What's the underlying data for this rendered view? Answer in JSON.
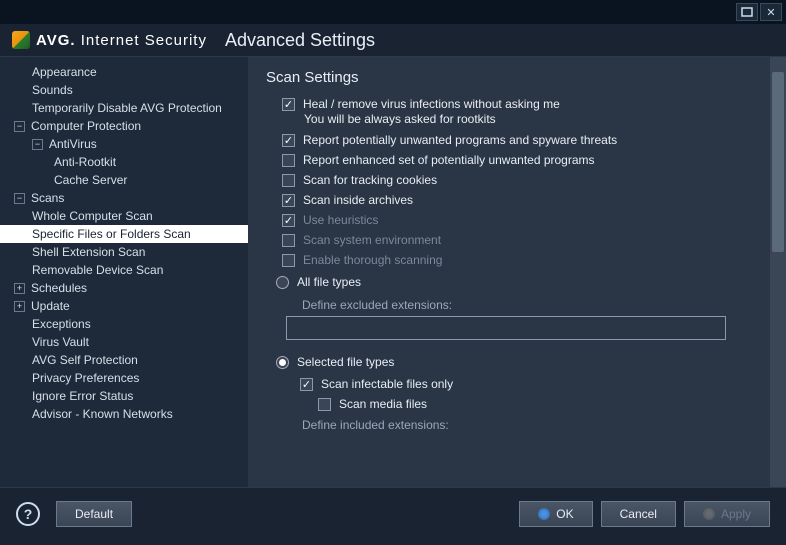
{
  "window": {
    "logo_brand": "AVG.",
    "logo_product": "Internet Security",
    "title": "Advanced Settings"
  },
  "sidebar": {
    "items": [
      {
        "label": "Appearance",
        "level": 1
      },
      {
        "label": "Sounds",
        "level": 1
      },
      {
        "label": "Temporarily Disable AVG Protection",
        "level": 1
      },
      {
        "label": "Computer Protection",
        "level": 0,
        "expand": "−"
      },
      {
        "label": "AntiVirus",
        "level": 1,
        "expand": "−"
      },
      {
        "label": "Anti-Rootkit",
        "level": 2
      },
      {
        "label": "Cache Server",
        "level": 2
      },
      {
        "label": "Scans",
        "level": 0,
        "expand": "−"
      },
      {
        "label": "Whole Computer Scan",
        "level": 1
      },
      {
        "label": "Specific Files or Folders Scan",
        "level": 1,
        "selected": true
      },
      {
        "label": "Shell Extension Scan",
        "level": 1
      },
      {
        "label": "Removable Device Scan",
        "level": 1
      },
      {
        "label": "Schedules",
        "level": 0,
        "expand": "+"
      },
      {
        "label": "Update",
        "level": 0,
        "expand": "+"
      },
      {
        "label": "Exceptions",
        "level": 1
      },
      {
        "label": "Virus Vault",
        "level": 1
      },
      {
        "label": "AVG Self Protection",
        "level": 1
      },
      {
        "label": "Privacy Preferences",
        "level": 1
      },
      {
        "label": "Ignore Error Status",
        "level": 1
      },
      {
        "label": "Advisor - Known Networks",
        "level": 1
      }
    ]
  },
  "content": {
    "heading": "Scan Settings",
    "checks": [
      {
        "label": "Heal / remove virus infections without asking me",
        "checked": true,
        "sub": "You will be always asked for rootkits"
      },
      {
        "label": "Report potentially unwanted programs and spyware threats",
        "checked": true
      },
      {
        "label": "Report enhanced set of potentially unwanted programs",
        "checked": false
      },
      {
        "label": "Scan for tracking cookies",
        "checked": false
      },
      {
        "label": "Scan inside archives",
        "checked": true
      },
      {
        "label": "Use heuristics",
        "checked": true,
        "dimmed": true
      },
      {
        "label": "Scan system environment",
        "checked": false,
        "dimmed": true
      },
      {
        "label": "Enable thorough scanning",
        "checked": false,
        "dimmed": true
      }
    ],
    "radio_all": "All file types",
    "excluded_label": "Define excluded extensions:",
    "excluded_value": "",
    "radio_selected": "Selected file types",
    "scan_infectable": {
      "label": "Scan infectable files only",
      "checked": true
    },
    "scan_media": {
      "label": "Scan media files",
      "checked": false
    },
    "included_label": "Define included extensions:"
  },
  "footer": {
    "default": "Default",
    "ok": "OK",
    "cancel": "Cancel",
    "apply": "Apply"
  }
}
